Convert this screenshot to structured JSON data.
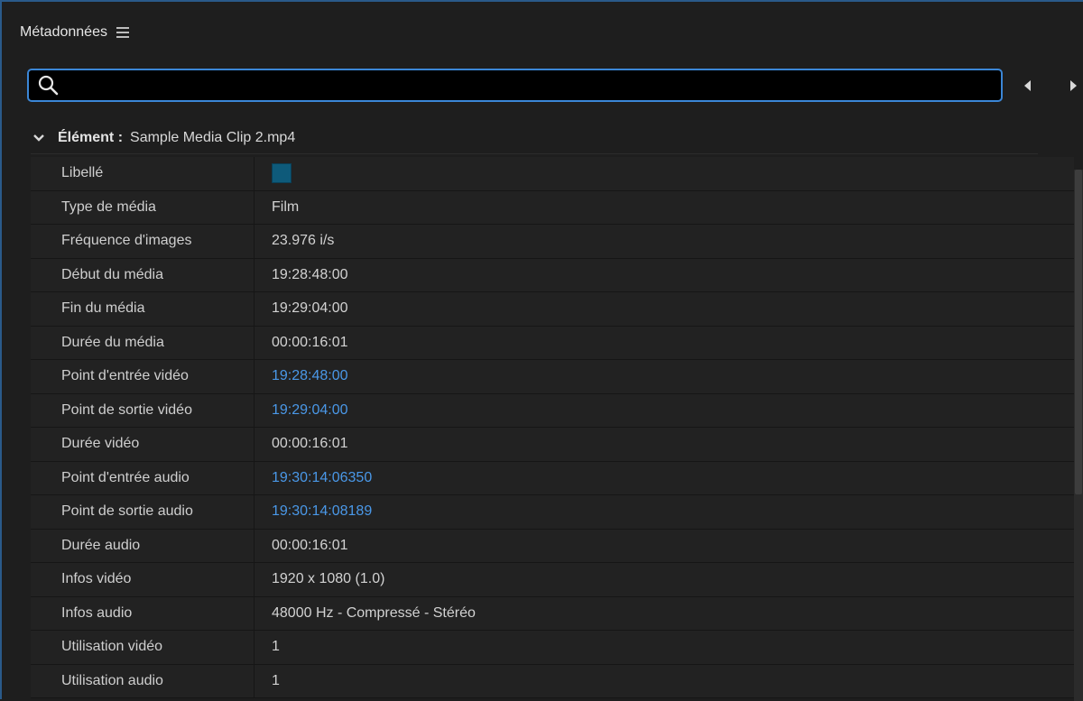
{
  "panel": {
    "title": "Métadonnées"
  },
  "search": {
    "value": "",
    "placeholder": ""
  },
  "section": {
    "label": "Élément :",
    "value": "Sample Media Clip 2.mp4"
  },
  "label_swatch_color": "#0e5a7a",
  "accent_link_color": "#4a98e8",
  "rows": [
    {
      "label": "Libellé",
      "value": ""
    },
    {
      "label": "Type de média",
      "value": "Film"
    },
    {
      "label": "Fréquence d'images",
      "value": "23.976 i/s"
    },
    {
      "label": "Début du média",
      "value": "19:28:48:00"
    },
    {
      "label": "Fin du média",
      "value": "19:29:04:00"
    },
    {
      "label": "Durée du média",
      "value": "00:00:16:01"
    },
    {
      "label": "Point d'entrée vidéo",
      "value": "19:28:48:00"
    },
    {
      "label": "Point de sortie vidéo",
      "value": "19:29:04:00"
    },
    {
      "label": "Durée vidéo",
      "value": "00:00:16:01"
    },
    {
      "label": "Point d'entrée audio",
      "value": "19:30:14:06350"
    },
    {
      "label": "Point de sortie audio",
      "value": "19:30:14:08189"
    },
    {
      "label": "Durée audio",
      "value": "00:00:16:01"
    },
    {
      "label": "Infos vidéo",
      "value": "1920 x 1080 (1.0)"
    },
    {
      "label": "Infos audio",
      "value": "48000 Hz - Compressé - Stéréo"
    },
    {
      "label": "Utilisation vidéo",
      "value": "1"
    },
    {
      "label": "Utilisation audio",
      "value": "1"
    }
  ]
}
